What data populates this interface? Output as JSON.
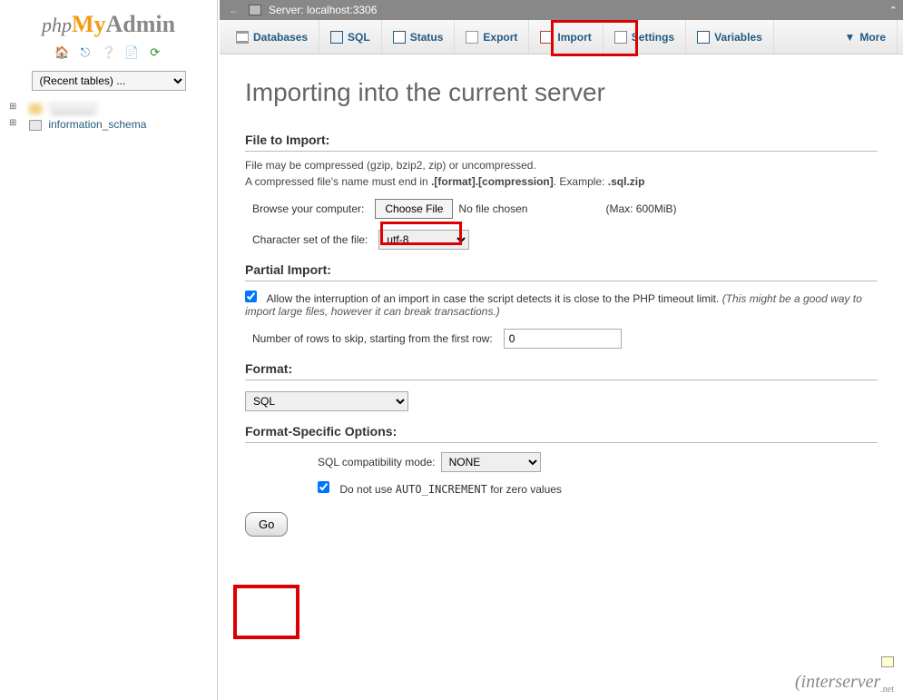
{
  "server_bar": {
    "label": "Server: localhost:3306"
  },
  "logo": {
    "php": "php",
    "my": "My",
    "admin": "Admin"
  },
  "sidebar": {
    "recent_placeholder": "(Recent tables) ...",
    "tree": [
      {
        "label": "_______",
        "blurred": true
      },
      {
        "label": "information_schema",
        "blurred": false
      }
    ]
  },
  "tabs": {
    "databases": "Databases",
    "sql": "SQL",
    "status": "Status",
    "export": "Export",
    "import": "Import",
    "settings": "Settings",
    "variables": "Variables",
    "more": "More"
  },
  "page": {
    "title": "Importing into the current server",
    "file_to_import": {
      "heading": "File to Import:",
      "line1": "File may be compressed (gzip, bzip2, zip) or uncompressed.",
      "line2a": "A compressed file's name must end in ",
      "line2b": ".[format].[compression]",
      "line2c": ". Example: ",
      "line2d": ".sql.zip",
      "browse_label": "Browse your computer:",
      "browse_button": "Choose File",
      "no_file": "No file chosen",
      "max": "(Max: 600MiB)",
      "charset_label": "Character set of the file:",
      "charset_value": "utf-8"
    },
    "partial": {
      "heading": "Partial Import:",
      "allow_label": "Allow the interruption of an import in case the script detects it is close to the PHP timeout limit. ",
      "allow_note": "(This might be a good way to import large files, however it can break transactions.)",
      "skip_label": "Number of rows to skip, starting from the first row:",
      "skip_value": "0"
    },
    "format": {
      "heading": "Format:",
      "value": "SQL"
    },
    "fso": {
      "heading": "Format-Specific Options:",
      "compat_label": "SQL compatibility mode:",
      "compat_value": "NONE",
      "noauto_label_a": "Do not use ",
      "noauto_code": "AUTO_INCREMENT",
      "noauto_label_b": " for zero values"
    },
    "go": "Go"
  },
  "watermark": {
    "brand": "interserver",
    "suffix": ".net"
  }
}
